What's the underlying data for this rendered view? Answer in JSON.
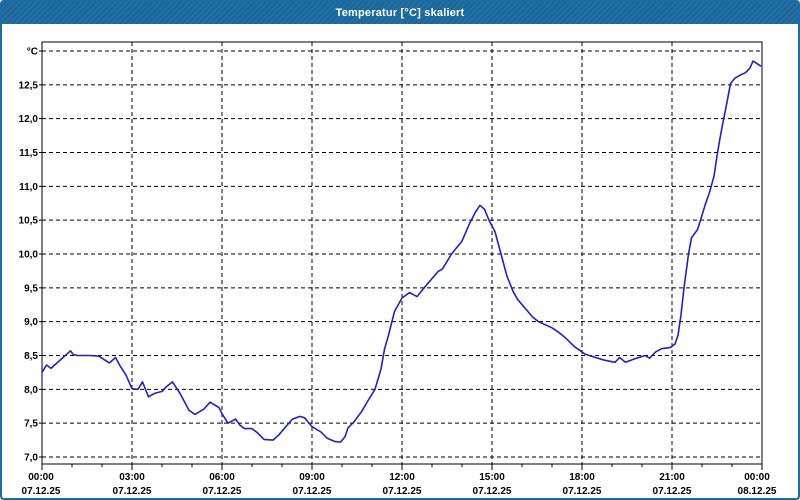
{
  "window": {
    "title": "Temperatur [°C] skaliert",
    "titlebar_color": "#1d6ca1",
    "border_color": "#1d6ca1"
  },
  "chart_data": {
    "type": "line",
    "title": "Temperatur [°C] skaliert",
    "ylabel": "°C",
    "grid": true,
    "legend": "none",
    "line_color": "#2222b8",
    "grid_color": "#000000",
    "frame_color": "#000000",
    "y_axis": {
      "unit_label": "°C",
      "tick_step": 0.5,
      "tick_values_top_to_bottom": [
        13.0,
        12.5,
        12.0,
        11.5,
        11.0,
        10.5,
        10.0,
        9.5,
        9.0,
        8.5,
        8.0,
        7.5,
        7.0
      ],
      "tick_labels_top_to_bottom": [
        "°C",
        "12,5",
        "12,0",
        "11,5",
        "11,0",
        "10,5",
        "10,0",
        "9,5",
        "9,0",
        "8,5",
        "8,0",
        "7,5",
        "7,0"
      ],
      "ylim": [
        6.9,
        13.1
      ]
    },
    "x_axis": {
      "range_hours": [
        0,
        24
      ],
      "minor_tick_every_hours": 1,
      "major_ticks": [
        {
          "hour": 0,
          "time": "00:00",
          "date": "07.12.25"
        },
        {
          "hour": 3,
          "time": "03:00",
          "date": "07.12.25"
        },
        {
          "hour": 6,
          "time": "06:00",
          "date": "07.12.25"
        },
        {
          "hour": 9,
          "time": "09:00",
          "date": "07.12.25"
        },
        {
          "hour": 12,
          "time": "12:00",
          "date": "07.12.25"
        },
        {
          "hour": 15,
          "time": "15:00",
          "date": "07.12.25"
        },
        {
          "hour": 18,
          "time": "18:00",
          "date": "07.12.25"
        },
        {
          "hour": 21,
          "time": "21:00",
          "date": "07.12.25"
        },
        {
          "hour": 24,
          "time": "00:00",
          "date": "08.12.25"
        }
      ]
    },
    "series": [
      {
        "name": "Temperatur [°C]",
        "points": [
          [
            0,
            8.25
          ],
          [
            0.15,
            8.36
          ],
          [
            0.3,
            8.31
          ],
          [
            0.5,
            8.39
          ],
          [
            0.65,
            8.45
          ],
          [
            0.8,
            8.51
          ],
          [
            0.95,
            8.57
          ],
          [
            1.05,
            8.51
          ],
          [
            1.2,
            8.5
          ],
          [
            1.6,
            8.5
          ],
          [
            1.9,
            8.49
          ],
          [
            2.1,
            8.43
          ],
          [
            2.25,
            8.39
          ],
          [
            2.45,
            8.47
          ],
          [
            2.6,
            8.35
          ],
          [
            2.8,
            8.21
          ],
          [
            3,
            8.01
          ],
          [
            3.2,
            8
          ],
          [
            3.35,
            8.11
          ],
          [
            3.55,
            7.89
          ],
          [
            3.75,
            7.94
          ],
          [
            4,
            7.97
          ],
          [
            4.15,
            8.04
          ],
          [
            4.35,
            8.11
          ],
          [
            4.6,
            7.94
          ],
          [
            4.9,
            7.69
          ],
          [
            5.1,
            7.63
          ],
          [
            5.4,
            7.71
          ],
          [
            5.6,
            7.81
          ],
          [
            5.9,
            7.73
          ],
          [
            6,
            7.64
          ],
          [
            6.2,
            7.5
          ],
          [
            6.45,
            7.56
          ],
          [
            6.6,
            7.47
          ],
          [
            6.75,
            7.42
          ],
          [
            7,
            7.42
          ],
          [
            7.2,
            7.35
          ],
          [
            7.4,
            7.26
          ],
          [
            7.7,
            7.25
          ],
          [
            7.9,
            7.33
          ],
          [
            8.15,
            7.46
          ],
          [
            8.35,
            7.56
          ],
          [
            8.6,
            7.6
          ],
          [
            8.75,
            7.58
          ],
          [
            9,
            7.45
          ],
          [
            9.3,
            7.37
          ],
          [
            9.5,
            7.28
          ],
          [
            9.75,
            7.23
          ],
          [
            9.95,
            7.22
          ],
          [
            10.1,
            7.3
          ],
          [
            10.2,
            7.43
          ],
          [
            10.4,
            7.52
          ],
          [
            10.65,
            7.67
          ],
          [
            10.85,
            7.82
          ],
          [
            11.1,
            8
          ],
          [
            11.3,
            8.3
          ],
          [
            11.42,
            8.6
          ],
          [
            11.55,
            8.8
          ],
          [
            11.75,
            9.15
          ],
          [
            12,
            9.35
          ],
          [
            12.25,
            9.43
          ],
          [
            12.5,
            9.37
          ],
          [
            12.85,
            9.56
          ],
          [
            13.2,
            9.74
          ],
          [
            13.35,
            9.78
          ],
          [
            13.65,
            10
          ],
          [
            14,
            10.19
          ],
          [
            14.25,
            10.45
          ],
          [
            14.45,
            10.62
          ],
          [
            14.6,
            10.72
          ],
          [
            14.75,
            10.66
          ],
          [
            14.9,
            10.5
          ],
          [
            15.1,
            10.33
          ],
          [
            15.3,
            10
          ],
          [
            15.5,
            9.67
          ],
          [
            15.7,
            9.45
          ],
          [
            15.85,
            9.33
          ],
          [
            16.1,
            9.2
          ],
          [
            16.35,
            9.07
          ],
          [
            16.55,
            9
          ],
          [
            16.75,
            8.96
          ],
          [
            17,
            8.91
          ],
          [
            17.2,
            8.85
          ],
          [
            17.45,
            8.76
          ],
          [
            17.75,
            8.63
          ],
          [
            17.95,
            8.57
          ],
          [
            18.1,
            8.52
          ],
          [
            18.45,
            8.47
          ],
          [
            18.75,
            8.43
          ],
          [
            19.1,
            8.4
          ],
          [
            19.25,
            8.47
          ],
          [
            19.45,
            8.4
          ],
          [
            19.75,
            8.45
          ],
          [
            20.1,
            8.5
          ],
          [
            20.25,
            8.46
          ],
          [
            20.45,
            8.55
          ],
          [
            20.65,
            8.6
          ],
          [
            20.95,
            8.62
          ],
          [
            21.1,
            8.67
          ],
          [
            21.2,
            8.8
          ],
          [
            21.3,
            9.1
          ],
          [
            21.4,
            9.5
          ],
          [
            21.55,
            10
          ],
          [
            21.65,
            10.24
          ],
          [
            21.85,
            10.36
          ],
          [
            21.95,
            10.5
          ],
          [
            22.1,
            10.72
          ],
          [
            22.25,
            10.91
          ],
          [
            22.4,
            11.15
          ],
          [
            22.5,
            11.45
          ],
          [
            22.6,
            11.71
          ],
          [
            22.7,
            11.95
          ],
          [
            22.78,
            12.12
          ],
          [
            22.87,
            12.33
          ],
          [
            22.95,
            12.52
          ],
          [
            23.1,
            12.6
          ],
          [
            23.3,
            12.65
          ],
          [
            23.45,
            12.68
          ],
          [
            23.6,
            12.75
          ],
          [
            23.7,
            12.85
          ],
          [
            23.85,
            12.81
          ],
          [
            23.95,
            12.78
          ]
        ]
      }
    ]
  }
}
